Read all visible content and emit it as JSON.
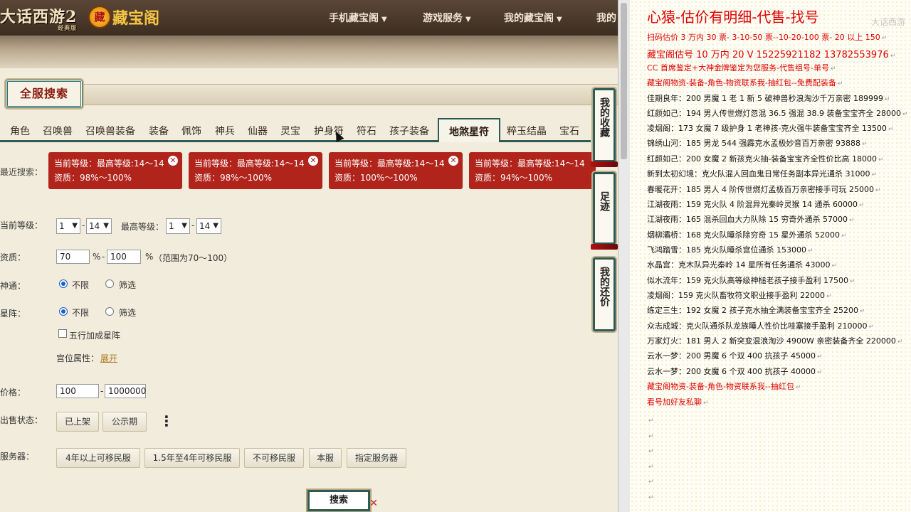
{
  "header": {
    "logo_game": "大话西游2",
    "logo_game_sub": "经典版",
    "logo_site": "藏宝阁",
    "logo_site_mark": "藏",
    "nav": [
      {
        "label": "手机藏宝阁"
      },
      {
        "label": "游戏服务"
      },
      {
        "label": "我的藏宝阁"
      },
      {
        "label": "我的"
      }
    ]
  },
  "page": {
    "all_search_title": "全服搜索",
    "tabs": [
      "角色",
      "召唤兽",
      "召唤兽装备",
      "装备",
      "佩饰",
      "神兵",
      "仙器",
      "灵宝",
      "护身符",
      "符石",
      "孩子装备",
      "地煞星符",
      "粹玉结晶",
      "宝石"
    ],
    "active_tab": "地煞星符",
    "recent_search_label": "最近搜索：",
    "recent_searches": [
      {
        "line1": "当前等级：最高等级:14～14",
        "line2": "资质：98%～100%"
      },
      {
        "line1": "当前等级：最高等级:14～14",
        "line2": "资质：98%～100%"
      },
      {
        "line1": "当前等级：最高等级:14～14",
        "line2": "资质：100%～100%"
      },
      {
        "line1": "当前等级：最高等级:14～14",
        "line2": "资质：94%～100%"
      }
    ],
    "close_glyph": "✕"
  },
  "form": {
    "current_level_label": "当前等级：",
    "current_level_min": "1",
    "current_level_max": "14",
    "max_level_label": "最高等级：",
    "max_level_min": "1",
    "max_level_max": "14",
    "aptitude_label": "资质：",
    "aptitude_min": "70",
    "aptitude_max": "100",
    "aptitude_unit": "%",
    "aptitude_hint": "（范围为70～100）",
    "shentong_label": "神通：",
    "xingzhen_label": "星阵：",
    "opt_unlimited": "不限",
    "opt_filter": "筛选",
    "wuxing_label": "五行加成星阵",
    "gongwei_label": "宫位属性：",
    "gongwei_link": "展开",
    "price_label": "价格：",
    "price_min": "100",
    "price_max": "1000000",
    "sale_status_label": "出售状态：",
    "sale_status_opts": [
      "已上架",
      "公示期"
    ],
    "more_glyph": "⋮",
    "server_label": "服务器：",
    "server_opts": [
      "4年以上可移民服",
      "1.5年至4年可移民服",
      "不可移民服",
      "本服",
      "指定服务器"
    ],
    "search_button": "搜索",
    "search_x": "✕"
  },
  "side_tabs": [
    "我的收藏",
    "足迹",
    "我的还价"
  ],
  "notes": {
    "watermark": "大话西游",
    "paragraph_mark": "↵",
    "lines": [
      {
        "text": "心猿-估价有明细-代售-找号",
        "style": "title"
      },
      {
        "text": "扫码估价 3 万内 30 票- 3-10-50 票--10-20-100 票- 20 以上 150",
        "style": "red"
      },
      {
        "text": "藏宝阁估号 10 万内 20 V 15225921182    13782553976",
        "style": "red-big"
      },
      {
        "text": "CC 首席鉴定+大神金牌鉴定为您服务-代售组号-单号",
        "style": "red"
      },
      {
        "text": "藏宝阁物资-装备-角色-物资联系我-抽红包--免费配装备",
        "style": "red"
      },
      {
        "text": "佳期良年：200 男魔 1 老 1 新 5 破神兽秒浪淘沙千万亲密 189999",
        "style": "normal"
      },
      {
        "text": "红颜如己：194 男人传世燃灯忽混 36.5 强混 38.9 装备宝宝齐全 28000",
        "style": "normal"
      },
      {
        "text": "凌烟阁：173 女魔 7 级护身 1 老神孩-克火强牛装备宝宝齐全 13500",
        "style": "normal"
      },
      {
        "text": "锦绣山河：185 男龙 544 强霹克水孟极妙音百万亲密 93888",
        "style": "normal"
      },
      {
        "text": "红颜如己：200 女魔 2 新孩克火抽-装备宝宝齐全性价比高 18000",
        "style": "normal"
      },
      {
        "text": "新到太初幻境：克火队混人回血鬼日常任务副本异光通杀 31000",
        "style": "normal"
      },
      {
        "text": "春暖花开：185 男人 4 阶传世燃灯孟极百万亲密接手可玩 25000",
        "style": "normal"
      },
      {
        "text": "江湖夜雨：159 克火队 4 阶混异光秦岭灵猴 14 通杀 60000",
        "style": "normal"
      },
      {
        "text": "江湖夜雨：165 混杀回血大力队除 15 穷奇外通杀 57000",
        "style": "normal"
      },
      {
        "text": "烟柳灞桥：168 克火队睡杀除穷奇 15 星外通杀 52000",
        "style": "normal"
      },
      {
        "text": "飞鸿踏雪：185 克火队睡杀宫位通杀 153000",
        "style": "normal"
      },
      {
        "text": "水晶宫：克木队异光秦岭 14 星所有任务通杀 43000",
        "style": "normal"
      },
      {
        "text": "似水流年：159 克火队高等级神槌老孩子接手盈利 17500",
        "style": "normal"
      },
      {
        "text": "凌烟阁：159 克火队畜牧符文职业接手盈利 22000",
        "style": "normal"
      },
      {
        "text": "练定三生：192 女魔 2 孩子克水抽全满装备宝宝齐全 25200",
        "style": "normal"
      },
      {
        "text": "众志成城：克火队通杀队龙族睡人性价比哇塞接手盈利 210000",
        "style": "normal"
      },
      {
        "text": "万家灯火：181 男人 2 新突变混浪淘沙 4900W 亲密装备齐全 220000",
        "style": "normal"
      },
      {
        "text": "云水一梦：200 男魔 6 个双 400 抗孩子 45000",
        "style": "normal"
      },
      {
        "text": "云水一梦：200 女魔 6 个双 400 抗孩子 40000",
        "style": "normal"
      },
      {
        "text": "藏宝阁物资-装备-角色-物资联系我--抽红包",
        "style": "red"
      },
      {
        "text": "看号加好友私聊",
        "style": "red"
      }
    ]
  },
  "colors": {
    "accent_red": "#b0241b",
    "teal_border": "#2e5a57",
    "note_red": "#e00000"
  }
}
